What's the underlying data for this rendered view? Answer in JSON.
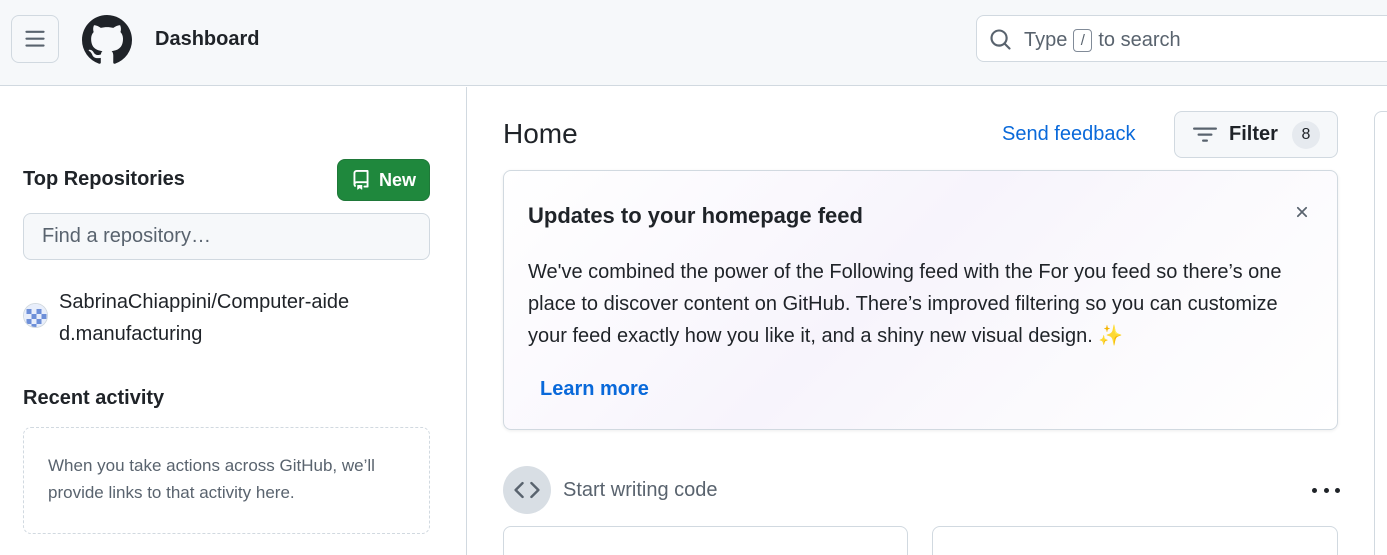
{
  "header": {
    "title": "Dashboard",
    "search_prefix": "Type",
    "search_key": "/",
    "search_suffix": "to search"
  },
  "sidebar": {
    "top_repositories_label": "Top Repositories",
    "new_button_label": "New",
    "find_repo_placeholder": "Find a repository…",
    "repositories": [
      {
        "name": "SabrinaChiappini/Computer-aided.manufacturing"
      }
    ],
    "recent_activity_label": "Recent activity",
    "recent_activity_empty": "When you take actions across GitHub, we’ll provide links to that activity here."
  },
  "main": {
    "title": "Home",
    "send_feedback_label": "Send feedback",
    "filter_label": "Filter",
    "filter_count": "8",
    "updates_card": {
      "title": "Updates to your homepage feed",
      "body": "We've combined the power of the Following feed with the For you feed so there’s one place to discover content on GitHub. There’s improved filtering so you can customize your feed exactly how you like it, and a shiny new visual design. ✨",
      "learn_more_label": "Learn more"
    },
    "start_writing_label": "Start writing code"
  },
  "colors": {
    "accent_blue": "#0969da",
    "new_button_green": "#1f883d",
    "header_bg": "#f6f8fa",
    "border": "#d1d9e0"
  },
  "icons": [
    "menu-icon",
    "github-logo-icon",
    "search-icon",
    "repo-icon",
    "filter-icon",
    "close-icon",
    "code-icon",
    "kebab-icon"
  ]
}
